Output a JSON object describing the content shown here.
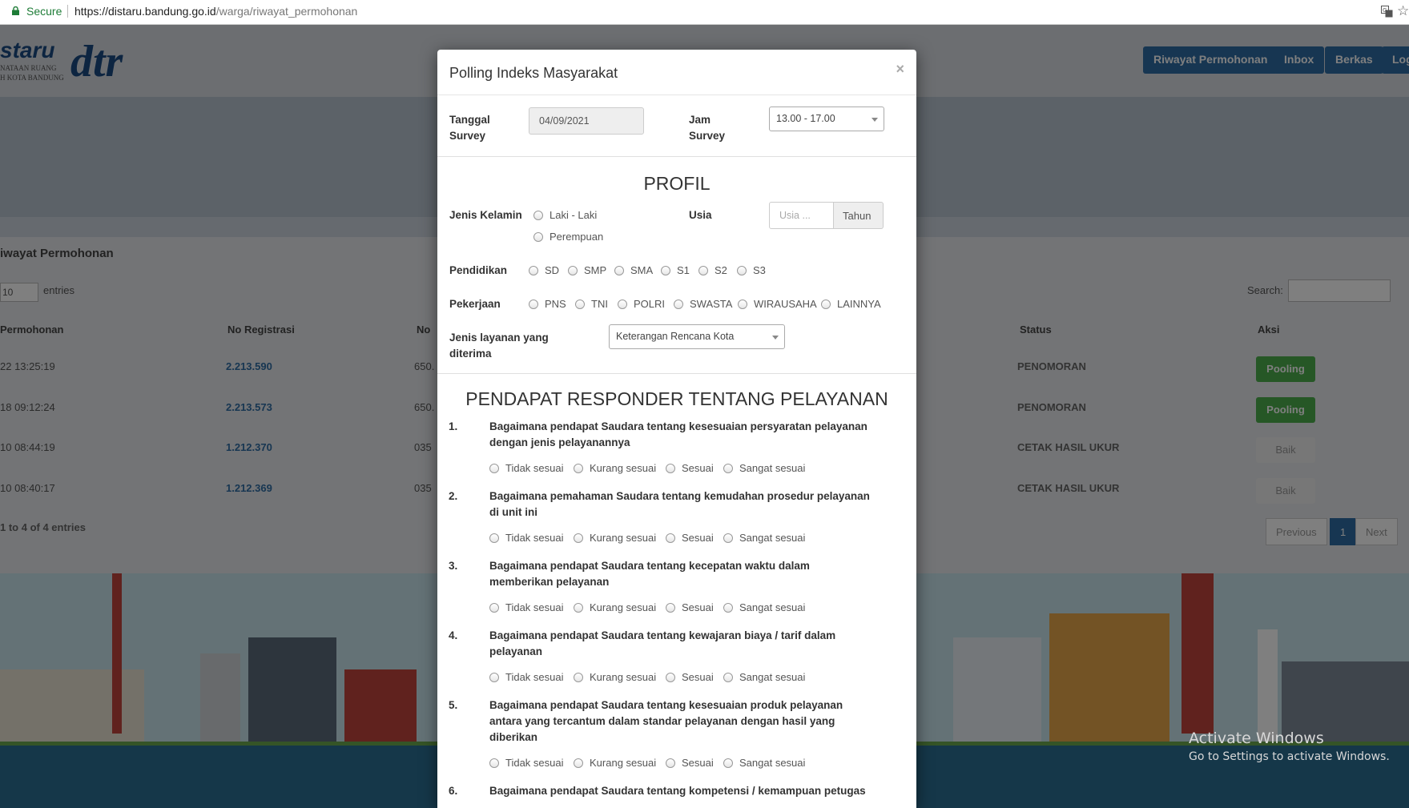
{
  "browser": {
    "secure_label": "Secure",
    "url_host": "https://distaru.bandung.go.id",
    "url_path": "/warga/riwayat_permohonan"
  },
  "background": {
    "logo_text": "staru",
    "logo_sub1": "NATAAN RUANG",
    "logo_sub2": "H KOTA BANDUNG",
    "logo_mark": "dtr",
    "nav": [
      "Riwayat Permohonan",
      "Inbox",
      "Berkas",
      "Log"
    ],
    "section_title": "iwayat Permohonan",
    "page_size": "10",
    "entries_label": "entries",
    "search_label": "Search:",
    "columns": [
      "Permohonan",
      "No Registrasi",
      "No",
      "Status",
      "Aksi"
    ],
    "rows": [
      {
        "date": "22 13:25:19",
        "reg": "2.213.590",
        "no": "650.",
        "status": "PENOMORAN",
        "action": "Pooling"
      },
      {
        "date": "18 09:12:24",
        "reg": "2.213.573",
        "no": "650.",
        "status": "PENOMORAN",
        "action": "Pooling"
      },
      {
        "date": "10 08:44:19",
        "reg": "1.212.370",
        "no": "035",
        "status": "CETAK HASIL UKUR",
        "action": "Baik"
      },
      {
        "date": "10 08:40:17",
        "reg": "1.212.369",
        "no": "035",
        "status": "CETAK HASIL UKUR",
        "action": "Baik"
      }
    ],
    "info": "1 to 4 of 4 entries",
    "pager": {
      "previous": "Previous",
      "page": "1",
      "next": "Next"
    }
  },
  "activate": {
    "line1": "Activate Windows",
    "line2": "Go to Settings to activate Windows."
  },
  "modal": {
    "title": "Polling Indeks Masyarakat",
    "close": "×",
    "tanggal_label_1": "Tanggal",
    "tanggal_label_2": "Survey",
    "tanggal_value": "04/09/2021",
    "jam_label_1": "Jam",
    "jam_label_2": "Survey",
    "jam_value": "13.00 - 17.00",
    "profil_heading": "PROFIL",
    "jenis_kelamin_label": "Jenis Kelamin",
    "gender_options": [
      "Laki - Laki",
      "Perempuan"
    ],
    "usia_label": "Usia",
    "usia_placeholder": "Usia ...",
    "usia_addon": "Tahun",
    "pendidikan_label": "Pendidikan",
    "pendidikan_options": [
      "SD",
      "SMP",
      "SMA",
      "S1",
      "S2",
      "S3"
    ],
    "pekerjaan_label": "Pekerjaan",
    "pekerjaan_options": [
      "PNS",
      "TNI",
      "POLRI",
      "SWASTA",
      "WIRAUSAHA",
      "LAINNYA"
    ],
    "layanan_label_1": "Jenis layanan yang",
    "layanan_label_2": "diterima",
    "layanan_value": "Keterangan Rencana Kota",
    "pendapat_heading": "PENDAPAT RESPONDER TENTANG PELAYANAN",
    "answer_options": [
      "Tidak sesuai",
      "Kurang sesuai",
      "Sesuai",
      "Sangat sesuai"
    ],
    "questions": [
      {
        "num": "1.",
        "line1": "Bagaimana pendapat Saudara tentang kesesuaian persyaratan pelayanan",
        "line2": "dengan jenis pelayanannya",
        "line3": ""
      },
      {
        "num": "2.",
        "line1": "Bagaimana pemahaman Saudara tentang kemudahan prosedur pelayanan",
        "line2": "di unit ini",
        "line3": ""
      },
      {
        "num": "3.",
        "line1": "Bagaimana pendapat Saudara tentang kecepatan waktu dalam",
        "line2": "memberikan pelayanan",
        "line3": ""
      },
      {
        "num": "4.",
        "line1": "Bagaimana pendapat Saudara tentang kewajaran biaya / tarif dalam",
        "line2": "pelayanan",
        "line3": ""
      },
      {
        "num": "5.",
        "line1": "Bagaimana pendapat Saudara tentang kesesuaian produk pelayanan",
        "line2": "antara yang tercantum dalam standar pelayanan dengan hasil yang",
        "line3": "diberikan"
      },
      {
        "num": "6.",
        "line1": "Bagaimana pendapat Saudara tentang kompetensi / kemampuan petugas",
        "line2": "",
        "line3": ""
      }
    ]
  }
}
